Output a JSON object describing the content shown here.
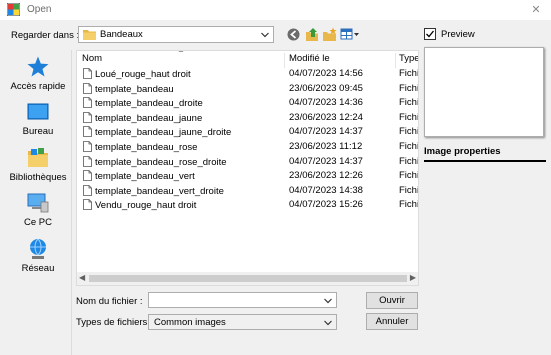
{
  "window": {
    "title": "Open"
  },
  "lookin": {
    "label": "Regarder dans :",
    "folder": "Bandeaux"
  },
  "places": [
    {
      "label": "Accès rapide",
      "icon": "star-icon"
    },
    {
      "label": "Bureau",
      "icon": "desktop-icon"
    },
    {
      "label": "Bibliothèques",
      "icon": "libraries-icon"
    },
    {
      "label": "Ce PC",
      "icon": "computer-icon"
    },
    {
      "label": "Réseau",
      "icon": "network-icon"
    }
  ],
  "filelist": {
    "columns": [
      "Nom",
      "Modifié le",
      "Type"
    ],
    "rows": [
      {
        "name": "Loué_rouge_haut droit",
        "date": "04/07/2023 14:56",
        "type": "Fichie"
      },
      {
        "name": "template_bandeau",
        "date": "23/06/2023 09:45",
        "type": "Fichie"
      },
      {
        "name": "template_bandeau_droite",
        "date": "04/07/2023 14:36",
        "type": "Fichie"
      },
      {
        "name": "template_bandeau_jaune",
        "date": "23/06/2023 12:24",
        "type": "Fichie"
      },
      {
        "name": "template_bandeau_jaune_droite",
        "date": "04/07/2023 14:37",
        "type": "Fichie"
      },
      {
        "name": "template_bandeau_rose",
        "date": "23/06/2023 11:12",
        "type": "Fichie"
      },
      {
        "name": "template_bandeau_rose_droite",
        "date": "04/07/2023 14:37",
        "type": "Fichie"
      },
      {
        "name": "template_bandeau_vert",
        "date": "23/06/2023 12:26",
        "type": "Fichie"
      },
      {
        "name": "template_bandeau_vert_droite",
        "date": "04/07/2023 14:38",
        "type": "Fichie"
      },
      {
        "name": "Vendu_rouge_haut droit",
        "date": "04/07/2023 15:26",
        "type": "Fichie"
      }
    ]
  },
  "preview": {
    "label": "Preview",
    "checked": true,
    "properties_label": "Image properties"
  },
  "filename": {
    "label": "Nom du fichier :",
    "value": ""
  },
  "filetype": {
    "label": "Types de fichiers :",
    "value": "Common images"
  },
  "buttons": {
    "open": "Ouvrir",
    "cancel": "Annuler"
  },
  "colors": {
    "accent": "#0078d7",
    "folder": "#e8b94a"
  }
}
